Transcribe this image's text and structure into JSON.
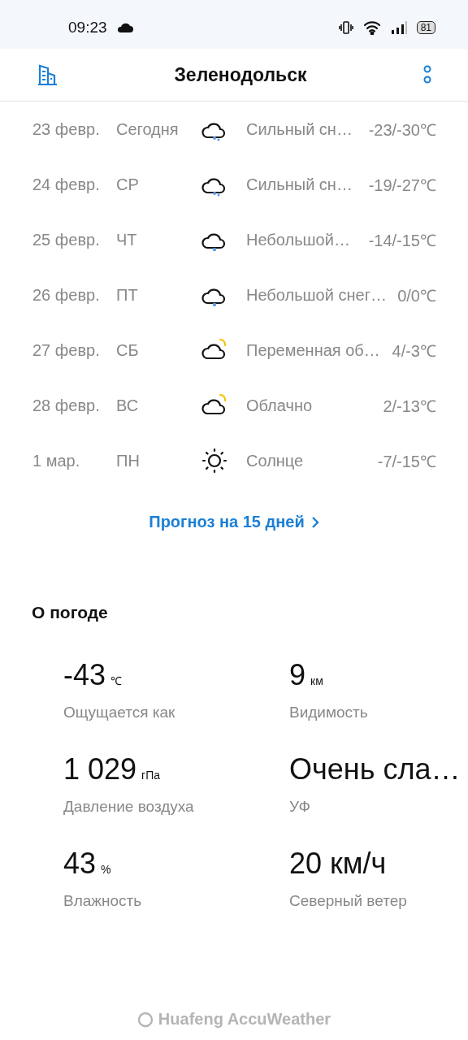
{
  "status_bar": {
    "time": "09:23",
    "battery": "81"
  },
  "header": {
    "title": "Зеленодольск"
  },
  "forecast": [
    {
      "date": "23 февр.",
      "day": "Сегодня",
      "kind": "heavysnow",
      "condition": "Сильный сн…",
      "temp": "-23/-30℃"
    },
    {
      "date": "24 февр.",
      "day": "СР",
      "kind": "heavysnow",
      "condition": "Сильный сн…",
      "temp": "-19/-27℃"
    },
    {
      "date": "25 февр.",
      "day": "ЧТ",
      "kind": "lightsnow",
      "condition": "Небольшой…",
      "temp": "-14/-15℃"
    },
    {
      "date": "26 февр.",
      "day": "ПТ",
      "kind": "lightsnow",
      "condition": "Небольшой снег…",
      "temp": "0/0℃"
    },
    {
      "date": "27 февр.",
      "day": "СБ",
      "kind": "partlycloudy",
      "condition": "Переменная об…",
      "temp": "4/-3℃"
    },
    {
      "date": "28 февр.",
      "day": "ВС",
      "kind": "partlycloudy",
      "condition": "Облачно",
      "temp": "2/-13℃"
    },
    {
      "date": "1 мар.",
      "day": "ПН",
      "kind": "sunny",
      "condition": "Солнце",
      "temp": "-7/-15℃"
    }
  ],
  "forecast_link": "Прогноз на 15 дней",
  "about": {
    "title": "О погоде",
    "items": [
      {
        "value": "-43",
        "unit": "℃",
        "label": "Ощущается как"
      },
      {
        "value": "9",
        "unit": "км",
        "label": "Видимость"
      },
      {
        "value": "1 029",
        "unit": "гПа",
        "label": "Давление воздуха"
      },
      {
        "value": "Очень сла…",
        "label": "УФ"
      },
      {
        "value": "43",
        "unit": "%",
        "label": "Влажность"
      },
      {
        "value": "20 км/ч",
        "label": "Северный ветер"
      }
    ]
  },
  "attribution": "Huafeng AccuWeather"
}
